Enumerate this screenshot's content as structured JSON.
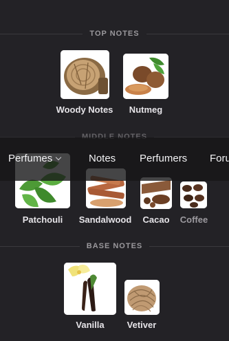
{
  "sections": {
    "top": {
      "title": "TOP NOTES",
      "notes": [
        {
          "label": "Woody Notes"
        },
        {
          "label": "Nutmeg"
        }
      ]
    },
    "middle": {
      "title": "MIDDLE NOTES",
      "notes": [
        {
          "label": "Patchouli"
        },
        {
          "label": "Sandalwood"
        },
        {
          "label": "Cacao"
        },
        {
          "label": "Coffee"
        }
      ]
    },
    "base": {
      "title": "BASE NOTES",
      "notes": [
        {
          "label": "Vanilla"
        },
        {
          "label": "Vetiver"
        }
      ]
    }
  },
  "nav": {
    "items": [
      {
        "label": "Perfumes"
      },
      {
        "label": "Notes"
      },
      {
        "label": "Perfumers"
      },
      {
        "label": "Forum"
      }
    ],
    "dropdown_icon": "chevron-down-icon"
  },
  "colors": {
    "background": "#232226",
    "navbar": "#161618",
    "section_title": "#9a989c",
    "label": "#e6e4e8"
  }
}
